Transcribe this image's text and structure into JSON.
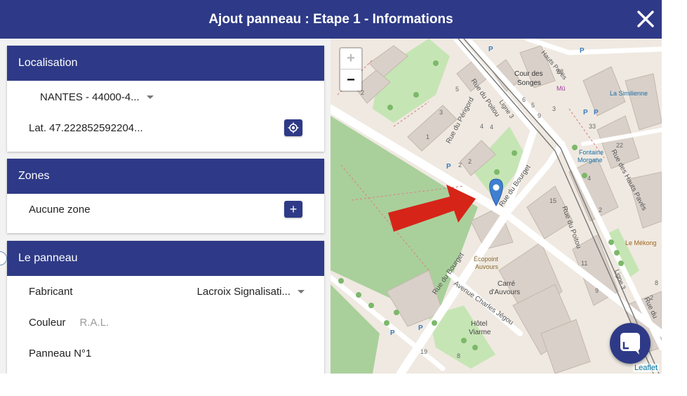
{
  "dialog": {
    "title": "Ajout panneau : Etape 1 - Informations"
  },
  "localisation": {
    "header": "Localisation",
    "commune": "NANTES - 44000-4...",
    "coordinates": "Lat. 47.222852592204..."
  },
  "zones": {
    "header": "Zones",
    "empty_label": "Aucune zone"
  },
  "panneau": {
    "header": "Le panneau",
    "fabricant_label": "Fabricant",
    "fabricant_value": "Lacroix Signalisati...",
    "couleur_label": "Couleur",
    "couleur_placeholder": "R.A.L.",
    "panneau_label": "Panneau N°1"
  },
  "map": {
    "zoom_in": "+",
    "zoom_out": "−",
    "attribution": "Leaflet",
    "street_labels": {
      "poitou_top": "Rue du Poitou",
      "perigord": "Rue du Périgord",
      "bourget_top": "Rue du Bourget",
      "bourget_bottom": "Rue du Bourget",
      "charles": "Avenue Charles Jégou",
      "hauts_paves": "Rue des Hauts Pavés",
      "poitou_right": "Rue du Poitou",
      "poitou_bottom": "Rue du",
      "ligne3_top": "Ligne 3",
      "ligne3_bottom": "Ligne 3",
      "pavés_top": "Hauts Pavés"
    },
    "poi_labels": {
      "cour_1": "Cour des",
      "cour_2": "Songes",
      "mu": "Mû",
      "similienne": "La Similienne",
      "fontaine_1": "Fontaine",
      "fontaine_2": "Morgane",
      "mekong": "Le Mékong",
      "ecopoint_1": "Écopoint",
      "ecopoint_2": "Auvours",
      "carre_1": "Carré",
      "carre_2": "d'Auvours",
      "hotel_1": "Hôtel",
      "hotel_2": "Viarme"
    },
    "numbers": [
      "5",
      "3",
      "1",
      "2",
      "4",
      "4",
      "6",
      "28",
      "5",
      "9",
      "3",
      "33",
      "22",
      "4",
      "2",
      "15",
      "11",
      "9",
      "8",
      "2",
      "19",
      "8",
      "2",
      "2"
    ]
  },
  "colors": {
    "primary": "#2e3a87",
    "marker": "#3e7fd1",
    "arrow": "#d62418",
    "park": "#c6e5b4",
    "cemetery": "#a9d09b"
  }
}
